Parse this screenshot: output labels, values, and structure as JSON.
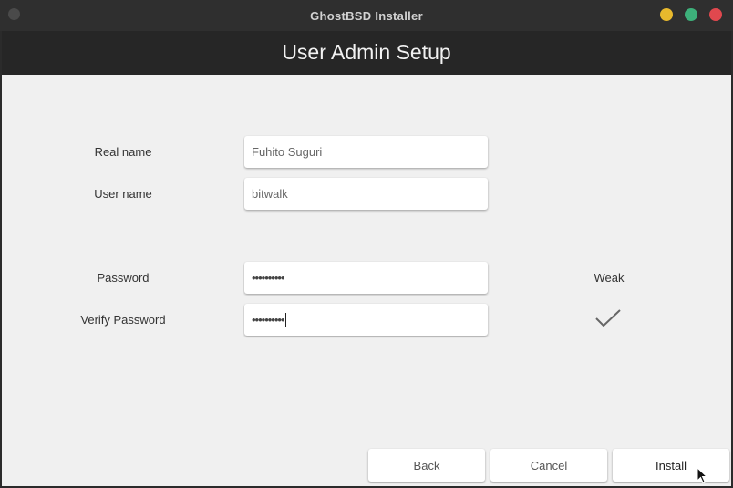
{
  "window": {
    "title": "GhostBSD Installer",
    "controls": {
      "minimize_color": "#e8b92d",
      "maximize_color": "#3db07a",
      "close_color": "#e0484e"
    }
  },
  "header": {
    "title": "User Admin Setup"
  },
  "form": {
    "real_name": {
      "label": "Real name",
      "value": "Fuhito Suguri"
    },
    "user_name": {
      "label": "User name",
      "value": "bitwalk"
    },
    "password": {
      "label": "Password",
      "masked_value": "••••••••••"
    },
    "verify_password": {
      "label": "Verify Password",
      "masked_value": "••••••••••"
    },
    "password_strength": "Weak",
    "match_indicator_icon": "checkmark-icon"
  },
  "buttons": {
    "back": "Back",
    "cancel": "Cancel",
    "install": "Install"
  },
  "colors": {
    "content_bg": "#f0f0f0",
    "header_bg": "#262626"
  }
}
